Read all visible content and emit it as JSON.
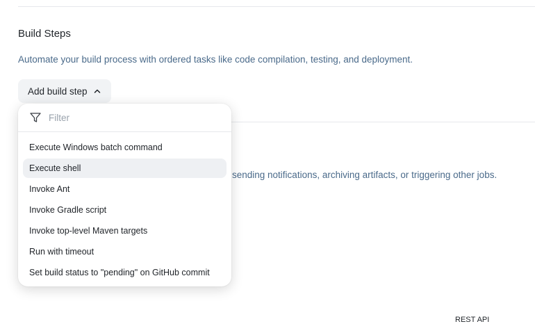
{
  "build_steps": {
    "title": "Build Steps",
    "description": "Automate your build process with ordered tasks like code compilation, testing, and deployment.",
    "add_button_label": "Add build step"
  },
  "post_build": {
    "description_visible": "sending notifications, archiving artifacts, or triggering other jobs."
  },
  "footer": {
    "partial_text": "REST API"
  },
  "dropdown": {
    "filter_placeholder": "Filter",
    "active_index": 1,
    "items": [
      {
        "label": "Execute Windows batch command"
      },
      {
        "label": "Execute shell"
      },
      {
        "label": "Invoke Ant"
      },
      {
        "label": "Invoke Gradle script"
      },
      {
        "label": "Invoke top-level Maven targets"
      },
      {
        "label": "Run with timeout"
      },
      {
        "label": "Set build status to \"pending\" on GitHub commit"
      }
    ]
  },
  "colors": {
    "description_text": "#4a6a8a",
    "button_bg": "#f1f3f5",
    "hover_bg": "#eef0f3"
  },
  "icons": {
    "filter": "filter-icon",
    "chevron": "chevron-up-icon"
  }
}
